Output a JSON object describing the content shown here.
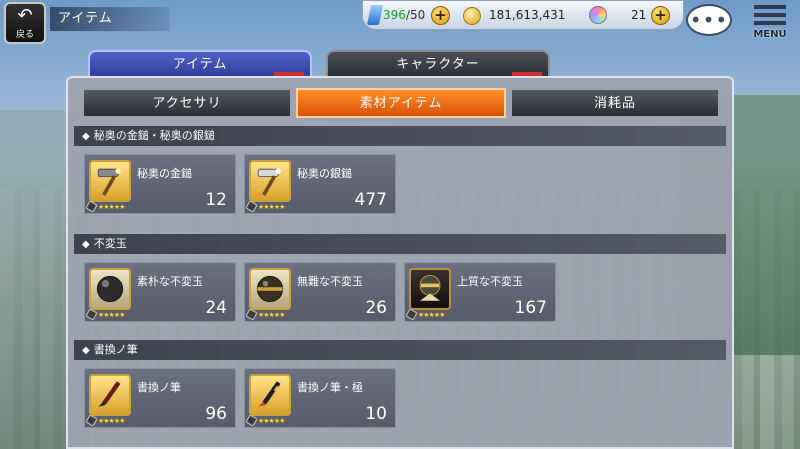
{
  "header": {
    "back_label": "戻る",
    "screen_title": "アイテム",
    "stamina_current": "396",
    "stamina_max": "/50",
    "money": "181,613,431",
    "gems": "21",
    "menu_label": "MENU",
    "chat_glyph": "•••"
  },
  "main_tabs": [
    {
      "label": "アイテム",
      "active": true
    },
    {
      "label": "キャラクター",
      "active": false
    }
  ],
  "sub_tabs": [
    {
      "label": "アクセサリ",
      "active": false
    },
    {
      "label": "素材アイテム",
      "active": true
    },
    {
      "label": "消耗品",
      "active": false
    }
  ],
  "sections": [
    {
      "title": "秘奥の金鎚・秘奥の銀鎚",
      "items": [
        {
          "name": "秘奥の金鎚",
          "count": "12",
          "icon": "gold-hammer-icon"
        },
        {
          "name": "秘奥の銀鎚",
          "count": "477",
          "icon": "silver-hammer-icon"
        }
      ]
    },
    {
      "title": "不変玉",
      "items": [
        {
          "name": "素朴な不変玉",
          "count": "24",
          "icon": "plain-orb-icon"
        },
        {
          "name": "無難な不変玉",
          "count": "26",
          "icon": "decent-orb-icon"
        },
        {
          "name": "上質な不変玉",
          "count": "167",
          "icon": "fine-orb-icon"
        }
      ]
    },
    {
      "title": "書換ノ筆",
      "items": [
        {
          "name": "書換ノ筆",
          "count": "96",
          "icon": "brush-icon"
        },
        {
          "name": "書換ノ筆・極",
          "count": "10",
          "icon": "brush-extreme-icon"
        }
      ]
    }
  ],
  "colors": {
    "active_main_tab": "#2d3c98",
    "active_sub_tab": "#e8661a",
    "panel": "#9ea3b1"
  },
  "section_marker": "◆",
  "rarity_stars": "★★★★★"
}
